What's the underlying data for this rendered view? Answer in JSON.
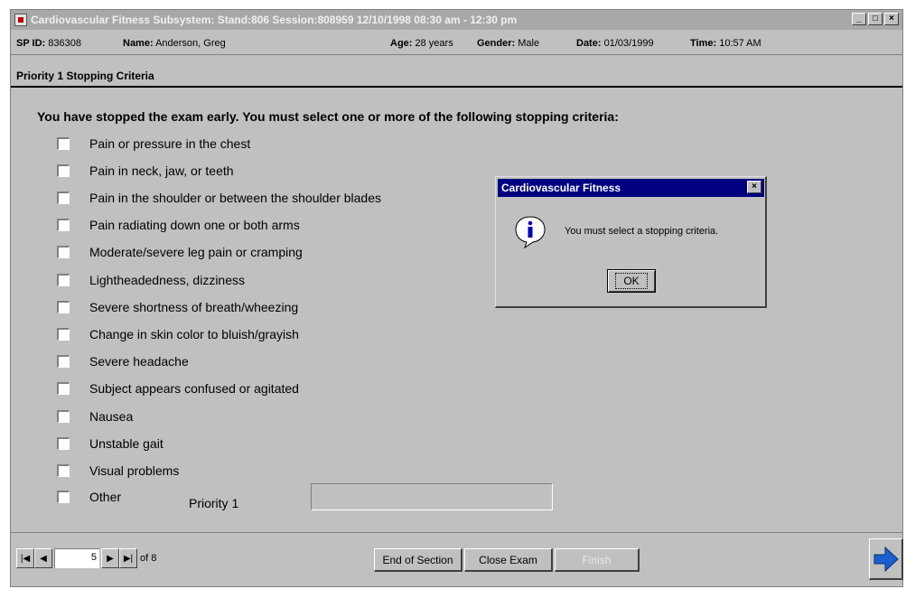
{
  "window": {
    "title": "Cardiovascular Fitness Subsystem: Stand:806 Session:808959 12/10/1998 08:30 am - 12:30 pm",
    "min_btn": "_",
    "max_btn": "□",
    "close_btn": "×"
  },
  "info": {
    "sp_id_label": "SP ID:",
    "sp_id": "836308",
    "name_label": "Name:",
    "name": "Anderson, Greg",
    "age_label": "Age:",
    "age": "28 years",
    "gender_label": "Gender:",
    "gender": "Male",
    "date_label": "Date:",
    "date": "01/03/1999",
    "time_label": "Time:",
    "time": "10:57 AM"
  },
  "section": {
    "title": "Priority 1 Stopping Criteria",
    "instruction": "You have stopped the exam early. You must select one or more of the following stopping criteria:"
  },
  "criteria": [
    {
      "label": "Pain or pressure in the chest",
      "checked": false
    },
    {
      "label": "Pain in neck, jaw, or teeth",
      "checked": false
    },
    {
      "label": "Pain in the shoulder or between the shoulder blades",
      "checked": false
    },
    {
      "label": "Pain radiating down one or both arms",
      "checked": false
    },
    {
      "label": "Moderate/severe leg pain or cramping",
      "checked": false
    },
    {
      "label": "Lightheadedness, dizziness",
      "checked": false
    },
    {
      "label": "Severe shortness of breath/wheezing",
      "checked": false
    },
    {
      "label": "Change in skin color to bluish/grayish",
      "checked": false
    },
    {
      "label": "Severe headache",
      "checked": false
    },
    {
      "label": "Subject appears confused or agitated",
      "checked": false
    },
    {
      "label": "Nausea",
      "checked": false
    },
    {
      "label": "Unstable gait",
      "checked": false
    },
    {
      "label": "Visual problems",
      "checked": false
    },
    {
      "label": "Other",
      "checked": false
    }
  ],
  "other": {
    "priority_label": "Priority 1",
    "value": ""
  },
  "nav": {
    "first": "|◀",
    "prev": "◀",
    "page": "5",
    "next": "▶",
    "last": "▶|",
    "of_pages": "of 8"
  },
  "buttons": {
    "end_section": "End of Section",
    "close_exam": "Close Exam",
    "finish": "Finish"
  },
  "dialog": {
    "title": "Cardiovascular Fitness",
    "message": "You must select a stopping criteria.",
    "ok": "OK",
    "close": "×",
    "icon": "info-icon",
    "icon_glyph": "i"
  },
  "colors": {
    "dialog_title_bg": "#000080",
    "window_title_bg": "#a8a8a8",
    "face": "#c0c0c0",
    "next_arrow": "#1a5fd0"
  }
}
